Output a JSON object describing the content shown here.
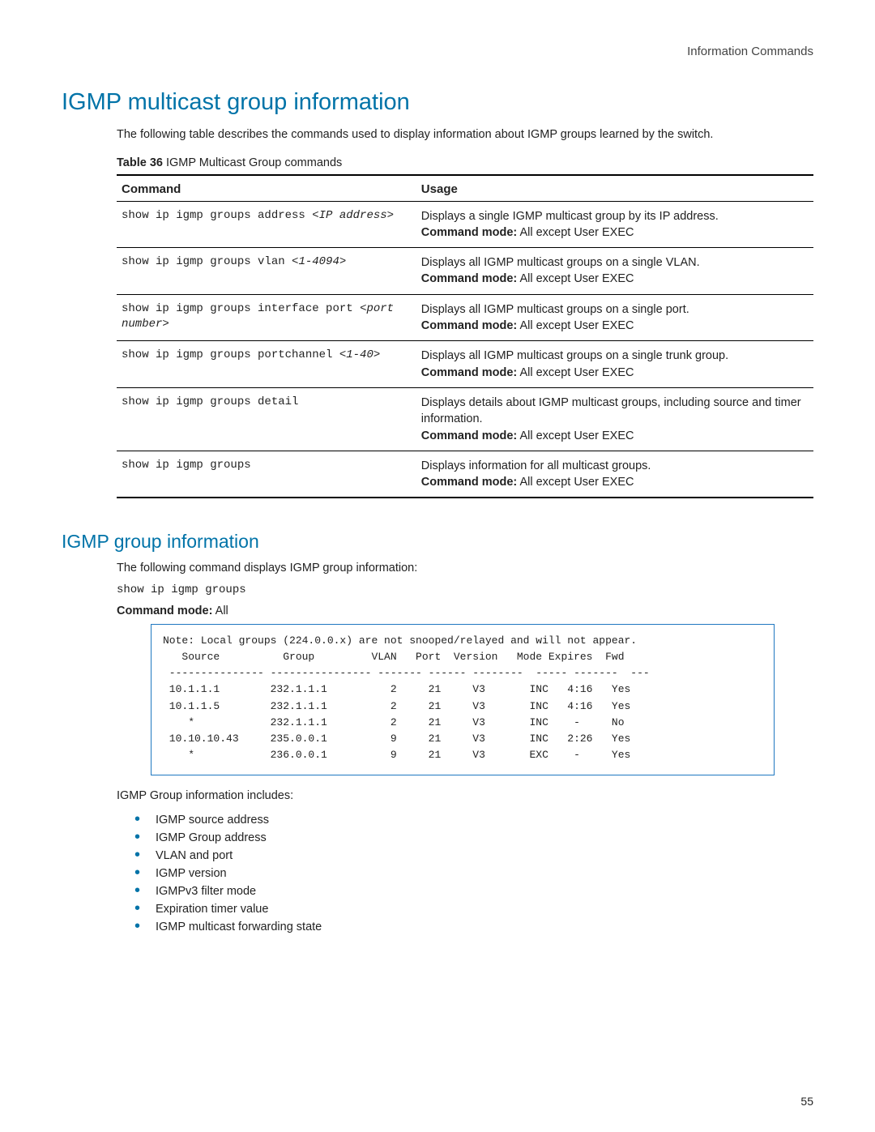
{
  "header": {
    "right": "Information Commands"
  },
  "h1": "IGMP multicast group information",
  "intro1": "The following table describes the commands used to display information about IGMP groups learned by the switch.",
  "table_caption": {
    "label": "Table 36",
    "text": "  IGMP Multicast Group commands"
  },
  "table": {
    "col1": "Command",
    "col2": "Usage",
    "rows": [
      {
        "cmd_plain": "show ip igmp groups address ",
        "cmd_italic": "<IP address>",
        "desc": "Displays a single IGMP multicast group by its IP address.",
        "mode_label": "Command mode:",
        "mode_val": " All except User EXEC"
      },
      {
        "cmd_plain": "show ip igmp groups vlan ",
        "cmd_italic": "<1-4094>",
        "desc": "Displays all IGMP multicast groups on a single VLAN.",
        "mode_label": "Command mode:",
        "mode_val": " All except User EXEC"
      },
      {
        "cmd_plain": "show ip igmp groups interface port ",
        "cmd_italic": "<port number>",
        "desc": "Displays all IGMP multicast groups on a single port.",
        "mode_label": "Command mode:",
        "mode_val": " All except User EXEC"
      },
      {
        "cmd_plain": "show ip igmp groups portchannel ",
        "cmd_italic": "<1-40>",
        "desc": "Displays all IGMP multicast groups on a single trunk group.",
        "mode_label": "Command mode:",
        "mode_val": " All except User EXEC"
      },
      {
        "cmd_plain": "show ip igmp groups detail",
        "cmd_italic": "",
        "desc": "Displays details about IGMP multicast groups, including source and timer information.",
        "mode_label": "Command mode:",
        "mode_val": " All except User EXEC"
      },
      {
        "cmd_plain": "show ip igmp groups",
        "cmd_italic": "",
        "desc": "Displays information for all multicast groups.",
        "mode_label": "Command mode:",
        "mode_val": " All except User EXEC"
      }
    ]
  },
  "h2": "IGMP group information",
  "para2": "The following command displays IGMP group information:",
  "mono_cmd": "show ip igmp groups",
  "mode_line": {
    "label": "Command mode:",
    "val": " All"
  },
  "code_output": "Note: Local groups (224.0.0.x) are not snooped/relayed and will not appear.\n   Source          Group         VLAN   Port  Version   Mode Expires  Fwd\n --------------- ---------------- ------- ------ --------  ----- -------  ---\n 10.1.1.1        232.1.1.1          2     21     V3       INC   4:16   Yes\n 10.1.1.5        232.1.1.1          2     21     V3       INC   4:16   Yes\n    *            232.1.1.1          2     21     V3       INC    -     No\n 10.10.10.43     235.0.0.1          9     21     V3       INC   2:26   Yes\n    *            236.0.0.1          9     21     V3       EXC    -     Yes",
  "includes_text": "IGMP Group information includes:",
  "bullets": [
    "IGMP source address",
    "IGMP Group address",
    "VLAN and port",
    "IGMP version",
    "IGMPv3 filter mode",
    "Expiration timer value",
    "IGMP multicast forwarding state"
  ],
  "page_number": "55"
}
